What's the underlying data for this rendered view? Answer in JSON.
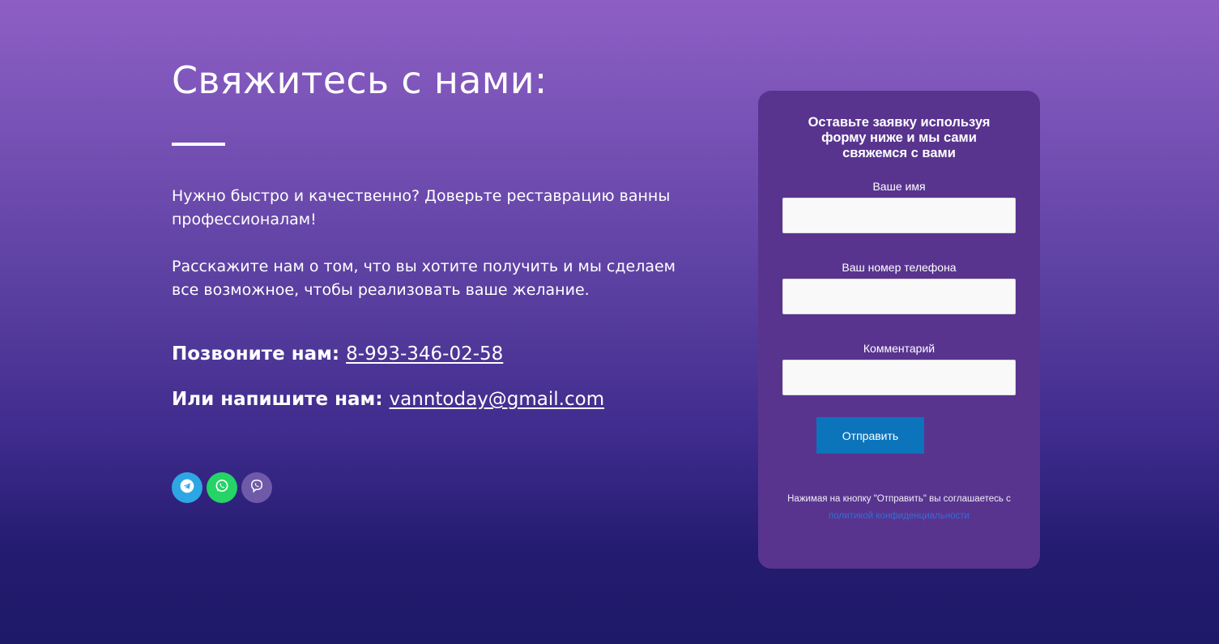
{
  "contact": {
    "title": "Свяжитесь с нами:",
    "paragraph1": "Нужно быстро и качественно? Доверьте реставрацию ванны профессионалам!",
    "paragraph2": "Расскажите нам о том, что вы хотите получить и мы сделаем все возможное, чтобы реализовать ваше желание.",
    "call_label": "Позвоните нам:",
    "phone": "8-993-346-02-58",
    "mail_label": "Или напишите нам:",
    "email": "vanntoday@gmail.com"
  },
  "socials": [
    {
      "name": "telegram",
      "icon": "telegram-icon",
      "color": "#2ea6e3"
    },
    {
      "name": "whatsapp",
      "icon": "whatsapp-icon",
      "color": "#25d366"
    },
    {
      "name": "viber",
      "icon": "viber-icon",
      "color": "#6e5aa8"
    }
  ],
  "form": {
    "heading": "Оставьте заявку используя форму ниже и мы сами свяжемся с вами",
    "name_label": "Ваше имя",
    "name_value": "",
    "phone_label": "Ваш номер телефона",
    "phone_value": "",
    "comment_label": "Комментарий",
    "comment_value": "",
    "submit_label": "Отправить",
    "consent_text": "Нажимая на кнопку \"Отправить\" вы соглашаетесь с",
    "privacy_link": "политикой конфиденциальности"
  },
  "colors": {
    "card_bg": "#58348f",
    "button": "#0c74bb",
    "link": "#2f6fd8"
  }
}
